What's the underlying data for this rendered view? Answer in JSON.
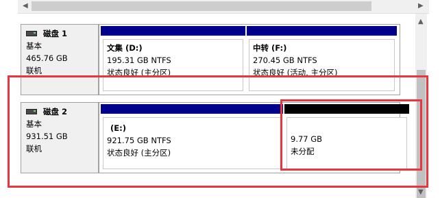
{
  "disks": [
    {
      "name": "磁盘 1",
      "type": "基本",
      "size": "465.76 GB",
      "status": "联机",
      "partitions": [
        {
          "name": "文集  (D:)",
          "size_fs": "195.31 GB NTFS",
          "status": "状态良好 (主分区)"
        },
        {
          "name": "中转  (F:)",
          "size_fs": "270.45 GB NTFS",
          "status": "状态良好 (活动, 主分区)"
        }
      ]
    },
    {
      "name": "磁盘 2",
      "type": "基本",
      "size": "931.51 GB",
      "status": "联机",
      "partitions": [
        {
          "name": "(E:)",
          "size_fs": "921.75 GB NTFS",
          "status": "状态良好 (主分区)"
        },
        {
          "size": "9.77 GB",
          "status": "未分配"
        }
      ]
    }
  ],
  "colors": {
    "primary_bar": "#00008b",
    "unallocated_bar": "#000000",
    "highlight": "#e8353e"
  }
}
